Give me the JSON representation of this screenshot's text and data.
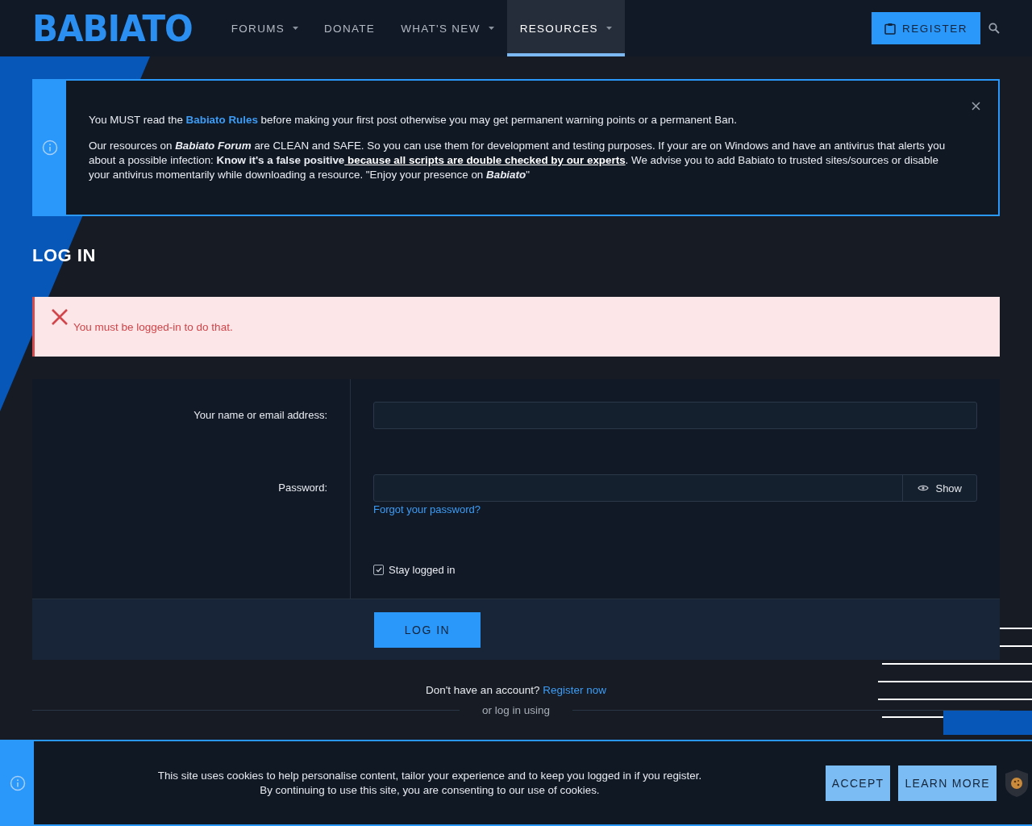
{
  "header": {
    "logo": "BABIATO",
    "nav": [
      {
        "label": "FORUMS",
        "dropdown": true,
        "selected": false
      },
      {
        "label": "DONATE",
        "dropdown": false,
        "selected": false
      },
      {
        "label": "WHAT'S NEW",
        "dropdown": true,
        "selected": false
      },
      {
        "label": "RESOURCES",
        "dropdown": true,
        "selected": true
      }
    ],
    "register_button": "REGISTER"
  },
  "notice": {
    "paragraphs": [
      [
        {
          "kind": "text",
          "text": "You MUST read the "
        },
        {
          "kind": "link",
          "text": "Babiato Rules"
        },
        {
          "kind": "text",
          "text": " before making your first post otherwise you may get permanent warning points or a permanent Ban."
        }
      ],
      [
        {
          "kind": "text",
          "text": "Our resources on *Babiato Forum* are CLEAN and SAFE. So you can use them for development and testing purposes. If your are on Windows and have an antivirus that alerts you about a possible infection: **Know it's a false positive**"
        },
        {
          "kind": "strong_link",
          "text": " because all scripts are double checked by our experts"
        },
        {
          "kind": "text",
          "text": ". We advise you to add Babiato to trusted sites/sources or disable your antivirus momentarily while downloading a resource. \"Enjoy your presence on *Babiato*\""
        }
      ]
    ]
  },
  "page_title": "LOG IN",
  "error": "You must be logged-in to do that.",
  "form": {
    "name_label": "Your name or email address:",
    "password_label": "Password:",
    "show_button": "Show",
    "forgot_link": "Forgot your password?",
    "stay_logged_in": {
      "label": "Stay logged in",
      "checked": true
    },
    "submit": "LOG IN"
  },
  "signup": {
    "text": "Don't have an account?",
    "link": "Register now"
  },
  "divider_text": "or log in using",
  "cookie_banner": {
    "lines": [
      "This site uses cookies to help personalise content, tailor your experience and to keep you logged in if you register.",
      "By continuing to use this site, you are consenting to our use of cookies."
    ],
    "accept": "ACCEPT",
    "learn_more": "LEARN MORE"
  }
}
